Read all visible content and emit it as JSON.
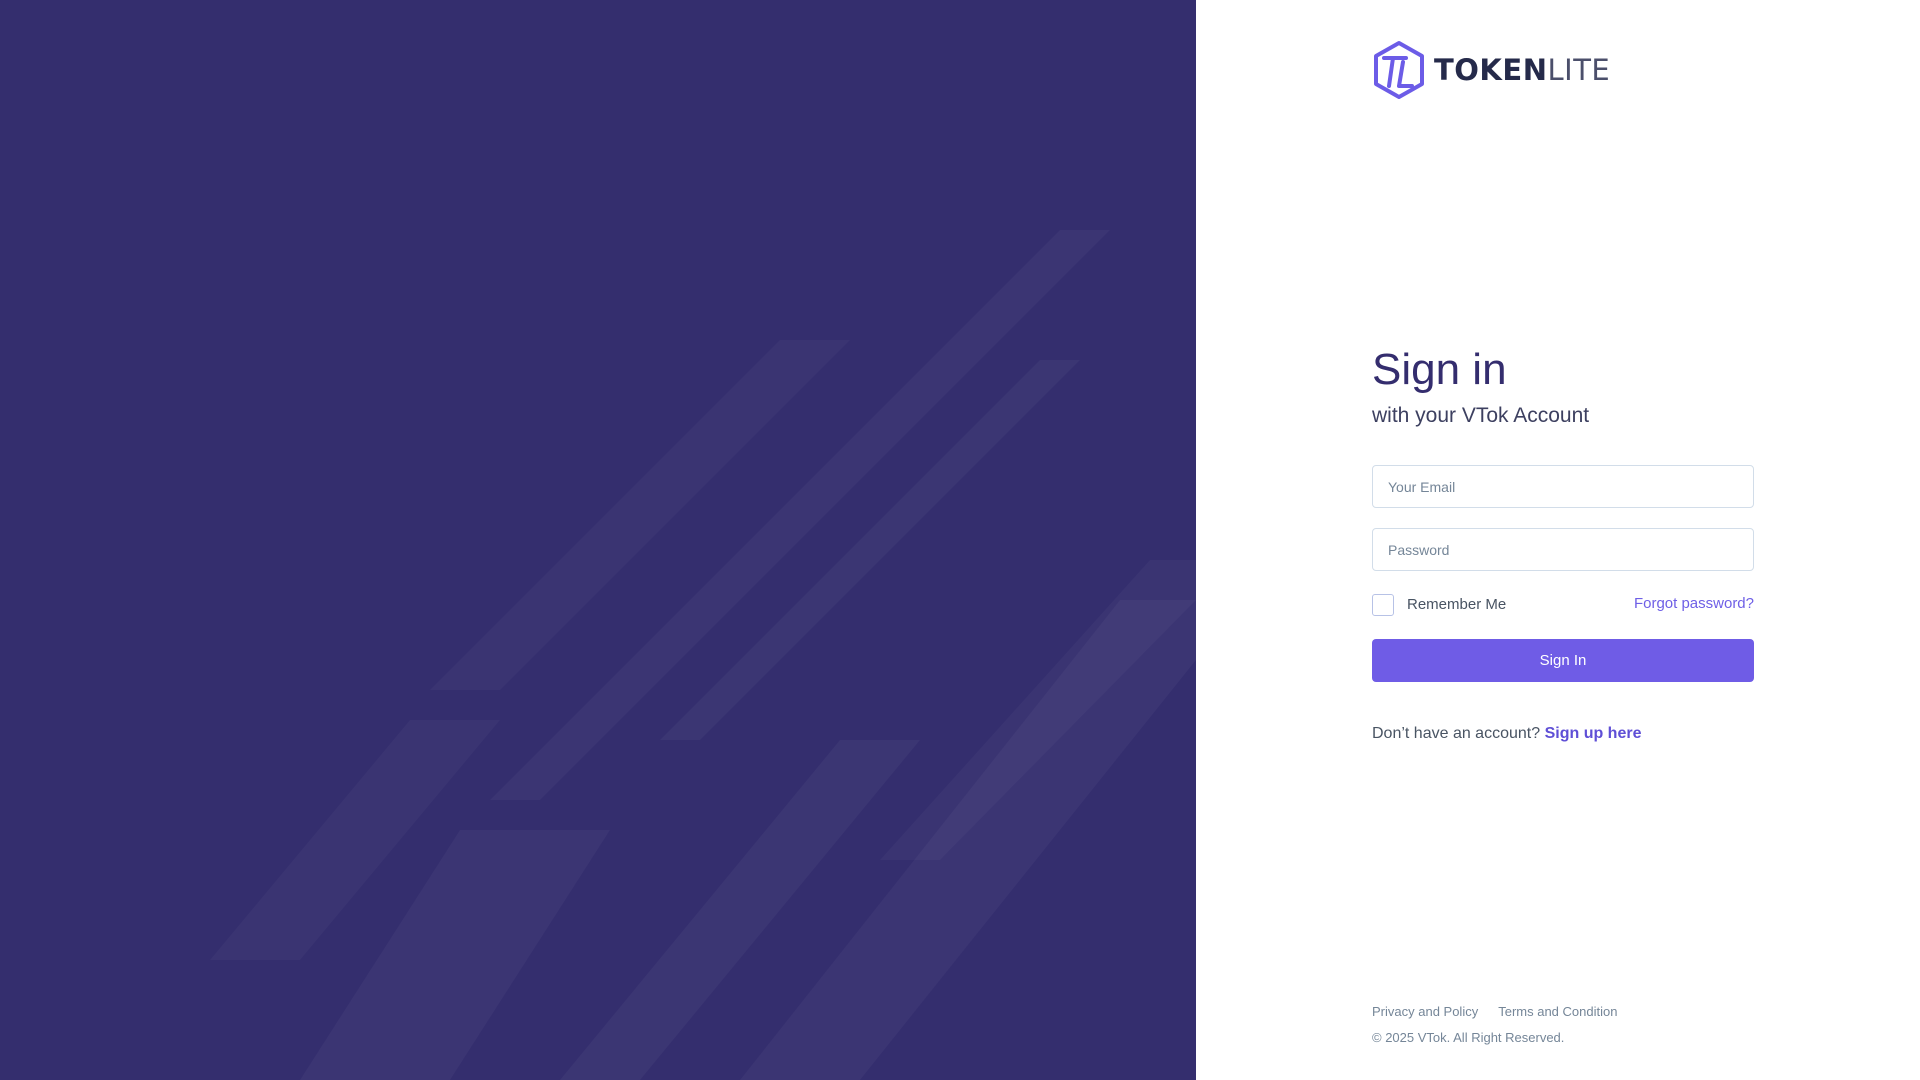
{
  "brand": {
    "logo_bold": "TOKEN",
    "logo_light": "LITE",
    "logo_icon": "hexagon-tl-logo-icon",
    "accent_color": "#6f5ce6",
    "panel_color": "#342e6e"
  },
  "form": {
    "title": "Sign in",
    "subtitle": "with your VTok Account",
    "email_placeholder": "Your Email",
    "email_value": "",
    "password_placeholder": "Password",
    "password_value": "",
    "remember_label": "Remember Me",
    "remember_checked": false,
    "forgot_label": "Forgot password?",
    "submit_label": "Sign In",
    "signup_prompt": "Don’t have an account?",
    "signup_link": "Sign up here"
  },
  "footer": {
    "privacy_label": "Privacy and Policy",
    "terms_label": "Terms and Condition",
    "copyright": "© 2025 VTok. All Right Reserved."
  }
}
